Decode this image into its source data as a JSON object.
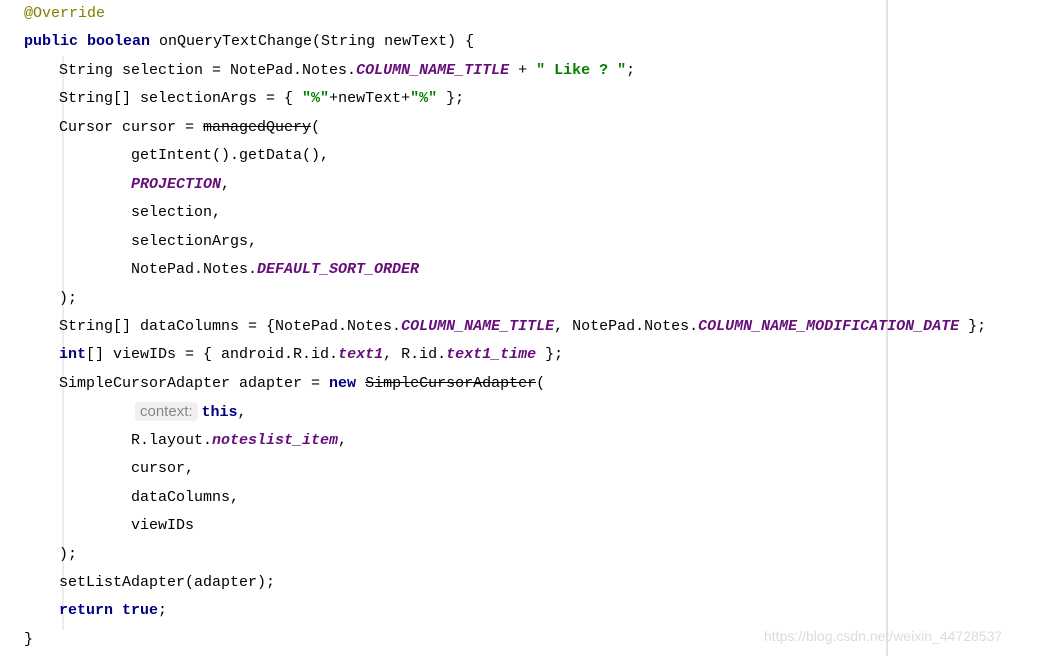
{
  "colors": {
    "keyword": "#000080",
    "string": "#008000",
    "static_field": "#660e7a",
    "annotation": "#808000",
    "background": "#ffffff"
  },
  "code_lines": [
    {
      "indent": 0,
      "tokens": [
        {
          "t": "@Override",
          "k": "ann"
        }
      ]
    },
    {
      "indent": 0,
      "tokens": [
        {
          "t": "public boolean",
          "k": "kw"
        },
        {
          "t": " onQueryTextChange(String newText) {",
          "k": ""
        }
      ]
    },
    {
      "indent": 1,
      "tokens": [
        {
          "t": "String selection = NotePad.Notes.",
          "k": ""
        },
        {
          "t": "COLUMN_NAME_TITLE",
          "k": "fld"
        },
        {
          "t": " + ",
          "k": ""
        },
        {
          "t": "\" Like ? \"",
          "k": "str"
        },
        {
          "t": ";",
          "k": ""
        }
      ]
    },
    {
      "indent": 1,
      "tokens": [
        {
          "t": "String[] selectionArgs = { ",
          "k": ""
        },
        {
          "t": "\"%\"",
          "k": "str"
        },
        {
          "t": "+newText+",
          "k": ""
        },
        {
          "t": "\"%\"",
          "k": "str"
        },
        {
          "t": " };",
          "k": ""
        }
      ]
    },
    {
      "indent": 1,
      "tokens": [
        {
          "t": "Cursor cursor = ",
          "k": ""
        },
        {
          "t": "managedQuery",
          "k": "dep"
        },
        {
          "t": "(",
          "k": ""
        }
      ]
    },
    {
      "indent": 2,
      "tokens": [
        {
          "t": "getIntent().getData(),",
          "k": ""
        }
      ]
    },
    {
      "indent": 2,
      "tokens": [
        {
          "t": "PROJECTION",
          "k": "fld"
        },
        {
          "t": ",",
          "k": ""
        }
      ]
    },
    {
      "indent": 2,
      "tokens": [
        {
          "t": "selection,",
          "k": ""
        }
      ]
    },
    {
      "indent": 2,
      "tokens": [
        {
          "t": "selectionArgs,",
          "k": ""
        }
      ]
    },
    {
      "indent": 2,
      "tokens": [
        {
          "t": "NotePad.Notes.",
          "k": ""
        },
        {
          "t": "DEFAULT_SORT_ORDER",
          "k": "fld"
        }
      ]
    },
    {
      "indent": 1,
      "tokens": [
        {
          "t": ");",
          "k": ""
        }
      ]
    },
    {
      "indent": 1,
      "tokens": [
        {
          "t": "String[] dataColumns = {NotePad.Notes.",
          "k": ""
        },
        {
          "t": "COLUMN_NAME_TITLE",
          "k": "fld"
        },
        {
          "t": ", NotePad.Notes.",
          "k": ""
        },
        {
          "t": "COLUMN_NAME_MODIFICATION_DATE",
          "k": "fld"
        },
        {
          "t": " };",
          "k": ""
        }
      ]
    },
    {
      "indent": 1,
      "tokens": [
        {
          "t": "int",
          "k": "kw"
        },
        {
          "t": "[] viewIDs = { android.R.id.",
          "k": ""
        },
        {
          "t": "text1",
          "k": "fld"
        },
        {
          "t": ", R.id.",
          "k": ""
        },
        {
          "t": "text1_time",
          "k": "fld"
        },
        {
          "t": " };",
          "k": ""
        }
      ]
    },
    {
      "indent": 1,
      "tokens": [
        {
          "t": "SimpleCursorAdapter adapter = ",
          "k": ""
        },
        {
          "t": "new",
          "k": "kw"
        },
        {
          "t": " ",
          "k": ""
        },
        {
          "t": "SimpleCursorAdapter",
          "k": "dep"
        },
        {
          "t": "(",
          "k": ""
        }
      ]
    },
    {
      "indent": 2,
      "tokens": [
        {
          "t": "context:",
          "k": "hint"
        },
        {
          "t": "this",
          "k": "kw"
        },
        {
          "t": ",",
          "k": ""
        }
      ]
    },
    {
      "indent": 2,
      "tokens": [
        {
          "t": "R.layout.",
          "k": ""
        },
        {
          "t": "noteslist_item",
          "k": "fld"
        },
        {
          "t": ",",
          "k": ""
        }
      ]
    },
    {
      "indent": 2,
      "tokens": [
        {
          "t": "cursor,",
          "k": ""
        }
      ]
    },
    {
      "indent": 2,
      "tokens": [
        {
          "t": "dataColumns,",
          "k": ""
        }
      ]
    },
    {
      "indent": 2,
      "tokens": [
        {
          "t": "viewIDs",
          "k": ""
        }
      ]
    },
    {
      "indent": 1,
      "tokens": [
        {
          "t": ");",
          "k": ""
        }
      ]
    },
    {
      "indent": 1,
      "tokens": [
        {
          "t": "setListAdapter(adapter);",
          "k": ""
        }
      ]
    },
    {
      "indent": 1,
      "tokens": [
        {
          "t": "return true",
          "k": "kw"
        },
        {
          "t": ";",
          "k": ""
        }
      ]
    },
    {
      "indent": 0,
      "tokens": [
        {
          "t": "}",
          "k": ""
        }
      ]
    }
  ],
  "watermark": "https://blog.csdn.net/weixin_44728537"
}
